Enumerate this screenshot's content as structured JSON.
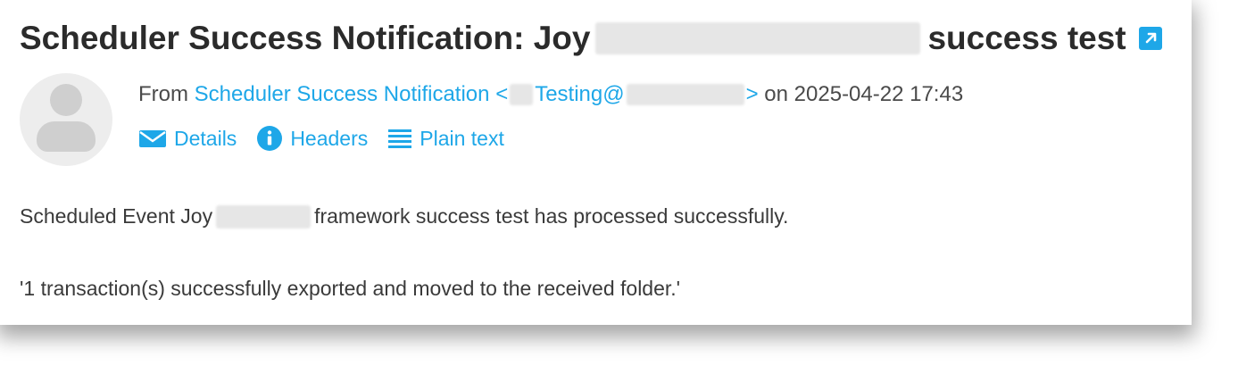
{
  "message": {
    "title_prefix": "Scheduler Success Notification: Joy",
    "title_suffix": "success test",
    "from_label": "From",
    "sender_name": "Scheduler Success Notification",
    "email_open": "<",
    "email_local": "Testing@",
    "email_close": ">",
    "date_prefix": "on",
    "date": "2025-04-22 17:43"
  },
  "actions": {
    "details": "Details",
    "headers": "Headers",
    "plain_text": "Plain text"
  },
  "body": {
    "line1_prefix": "Scheduled Event Joy",
    "line1_suffix": "framework success test has processed successfully.",
    "line2": "'1 transaction(s) successfully exported and moved to the received folder.'"
  },
  "colors": {
    "accent": "#1ea7e8",
    "title": "#2b2b2b",
    "text": "#3a3a3a"
  },
  "icons": {
    "external_link": "external-link-icon",
    "envelope": "envelope-icon",
    "info": "info-icon",
    "lines": "lines-icon"
  }
}
